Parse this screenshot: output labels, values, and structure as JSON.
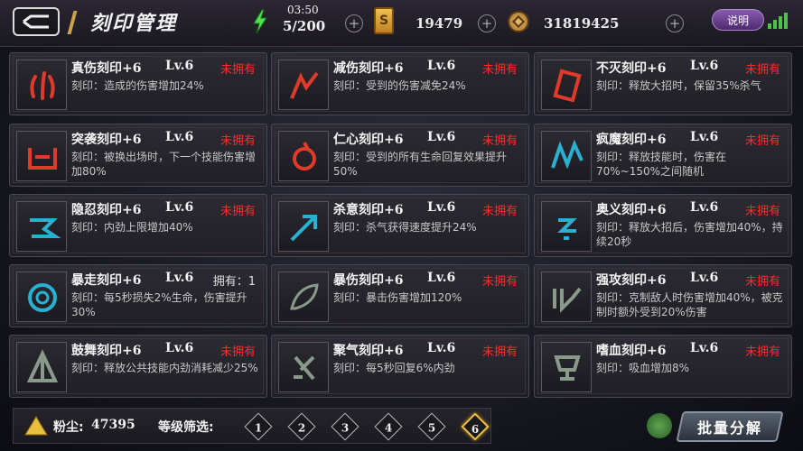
{
  "header": {
    "title": "刻印管理",
    "energy_time": "03:50",
    "energy_count": "5/200",
    "tickets": "19479",
    "coins": "31819425",
    "help_label": "说明"
  },
  "colors": {
    "not_owned": "#ff2a2a",
    "accent_gold": "#f0c040"
  },
  "cards": [
    {
      "name": "真伤刻印+6",
      "level": "Lv.6",
      "status": "未拥有",
      "owned": false,
      "desc": "刻印：造成的伤害增加24%",
      "icon": "triple-claw-icon",
      "tint": "#e03a2a"
    },
    {
      "name": "减伤刻印+6",
      "level": "Lv.6",
      "status": "未拥有",
      "owned": false,
      "desc": "刻印：受到的伤害减免24%",
      "icon": "slash-icon",
      "tint": "#e03a2a"
    },
    {
      "name": "不灭刻印+6",
      "level": "Lv.6",
      "status": "未拥有",
      "owned": false,
      "desc": "刻印：释放大招时，保留35%杀气",
      "icon": "card-icon",
      "tint": "#e03a2a"
    },
    {
      "name": "突袭刻印+6",
      "level": "Lv.6",
      "status": "未拥有",
      "owned": false,
      "desc": "刻印：被换出场时，下一个技能伤害增加80%",
      "icon": "bracket-icon",
      "tint": "#e03a2a"
    },
    {
      "name": "仁心刻印+6",
      "level": "Lv.6",
      "status": "未拥有",
      "owned": false,
      "desc": "刻印：受到的所有生命回复效果提升50%",
      "icon": "swirl-icon",
      "tint": "#e03a2a"
    },
    {
      "name": "疯魔刻印+6",
      "level": "Lv.6",
      "status": "未拥有",
      "owned": false,
      "desc": "刻印：释放技能时，伤害在70%~150%之间随机",
      "icon": "zigzag-icon",
      "tint": "#2ab0d0"
    },
    {
      "name": "隐忍刻印+6",
      "level": "Lv.6",
      "status": "未拥有",
      "owned": false,
      "desc": "刻印：内劲上限增加40%",
      "icon": "ribbon-icon",
      "tint": "#2ab0d0"
    },
    {
      "name": "杀意刻印+6",
      "level": "Lv.6",
      "status": "未拥有",
      "owned": false,
      "desc": "刻印：杀气获得速度提升24%",
      "icon": "arrow-icon",
      "tint": "#2ab0d0"
    },
    {
      "name": "奥义刻印+6",
      "level": "Lv.6",
      "status": "未拥有",
      "owned": false,
      "desc": "刻印：释放大招后，伤害增加40%，持续20秒",
      "icon": "rune-icon",
      "tint": "#2ab0d0"
    },
    {
      "name": "暴走刻印+6",
      "level": "Lv.6",
      "status": "拥有：1",
      "owned": true,
      "desc": "刻印：每5秒损失2%生命，伤害提升30%",
      "icon": "ring-icon",
      "tint": "#2ab0d0"
    },
    {
      "name": "暴伤刻印+6",
      "level": "Lv.6",
      "status": "未拥有",
      "owned": false,
      "desc": "刻印：暴击伤害增加120%",
      "icon": "leaf-icon",
      "tint": "#8a9a8a"
    },
    {
      "name": "强攻刻印+6",
      "level": "Lv.6",
      "status": "未拥有",
      "owned": false,
      "desc": "刻印：克制敌人时伤害增加40%，被克制时额外受到20%伤害",
      "icon": "glyph-icon",
      "tint": "#8a9a8a"
    },
    {
      "name": "鼓舞刻印+6",
      "level": "Lv.6",
      "status": "未拥有",
      "owned": false,
      "desc": "刻印：释放公共技能内劲消耗减少25%",
      "icon": "tent-icon",
      "tint": "#8a9a8a"
    },
    {
      "name": "聚气刻印+6",
      "level": "Lv.6",
      "status": "未拥有",
      "owned": false,
      "desc": "刻印：每5秒回复6%内劲",
      "icon": "sigil-icon",
      "tint": "#8a9a8a"
    },
    {
      "name": "嗜血刻印+6",
      "level": "Lv.6",
      "status": "未拥有",
      "owned": false,
      "desc": "刻印：吸血增加8%",
      "icon": "cup-icon",
      "tint": "#8a9a8a"
    }
  ],
  "footer": {
    "dust_label": "粉尘:",
    "dust_value": "47395",
    "filter_label": "等级筛选:",
    "levels": [
      "1",
      "2",
      "3",
      "4",
      "5",
      "6"
    ],
    "active_level": "6",
    "decompose_label": "批量分解"
  }
}
